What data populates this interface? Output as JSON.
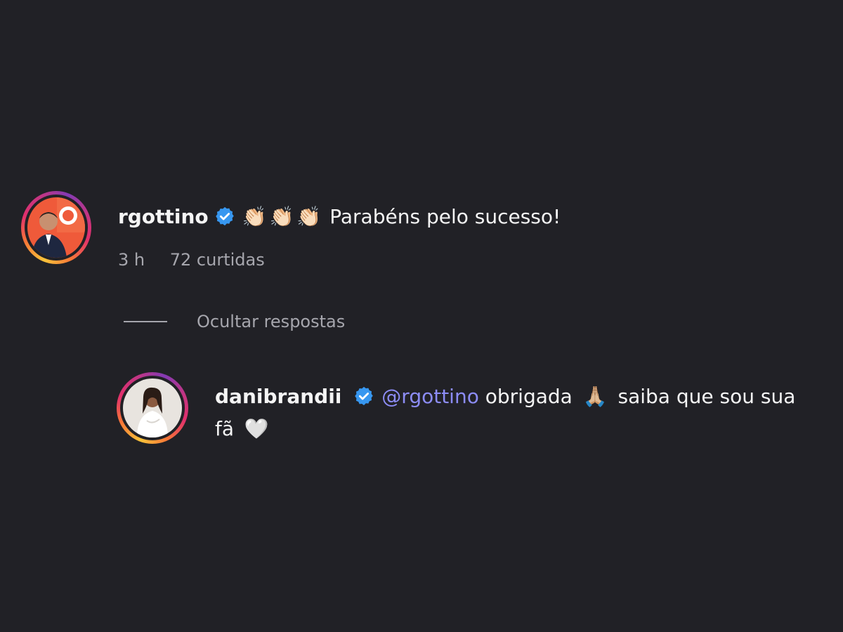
{
  "comment": {
    "username": "rgottino",
    "verified": true,
    "emojis": [
      "👏🏻",
      "👏🏻",
      "👏🏻"
    ],
    "text": "Parabéns pelo sucesso!",
    "time": "3 h",
    "likes": "72 curtidas"
  },
  "replies_toggle": {
    "label": "Ocultar respostas"
  },
  "reply": {
    "username": "danibrandii",
    "verified": true,
    "mention": "@rgottino",
    "text_part1": "obrigada",
    "emoji_pray": "🙏🏼",
    "text_part2": "saiba que sou sua fã",
    "emoji_heart": "🤍"
  },
  "colors": {
    "background": "#212126",
    "text": "#f5f5f5",
    "muted": "#a6a6ad",
    "mention": "#8c8cf5",
    "verified": "#3797f0"
  }
}
